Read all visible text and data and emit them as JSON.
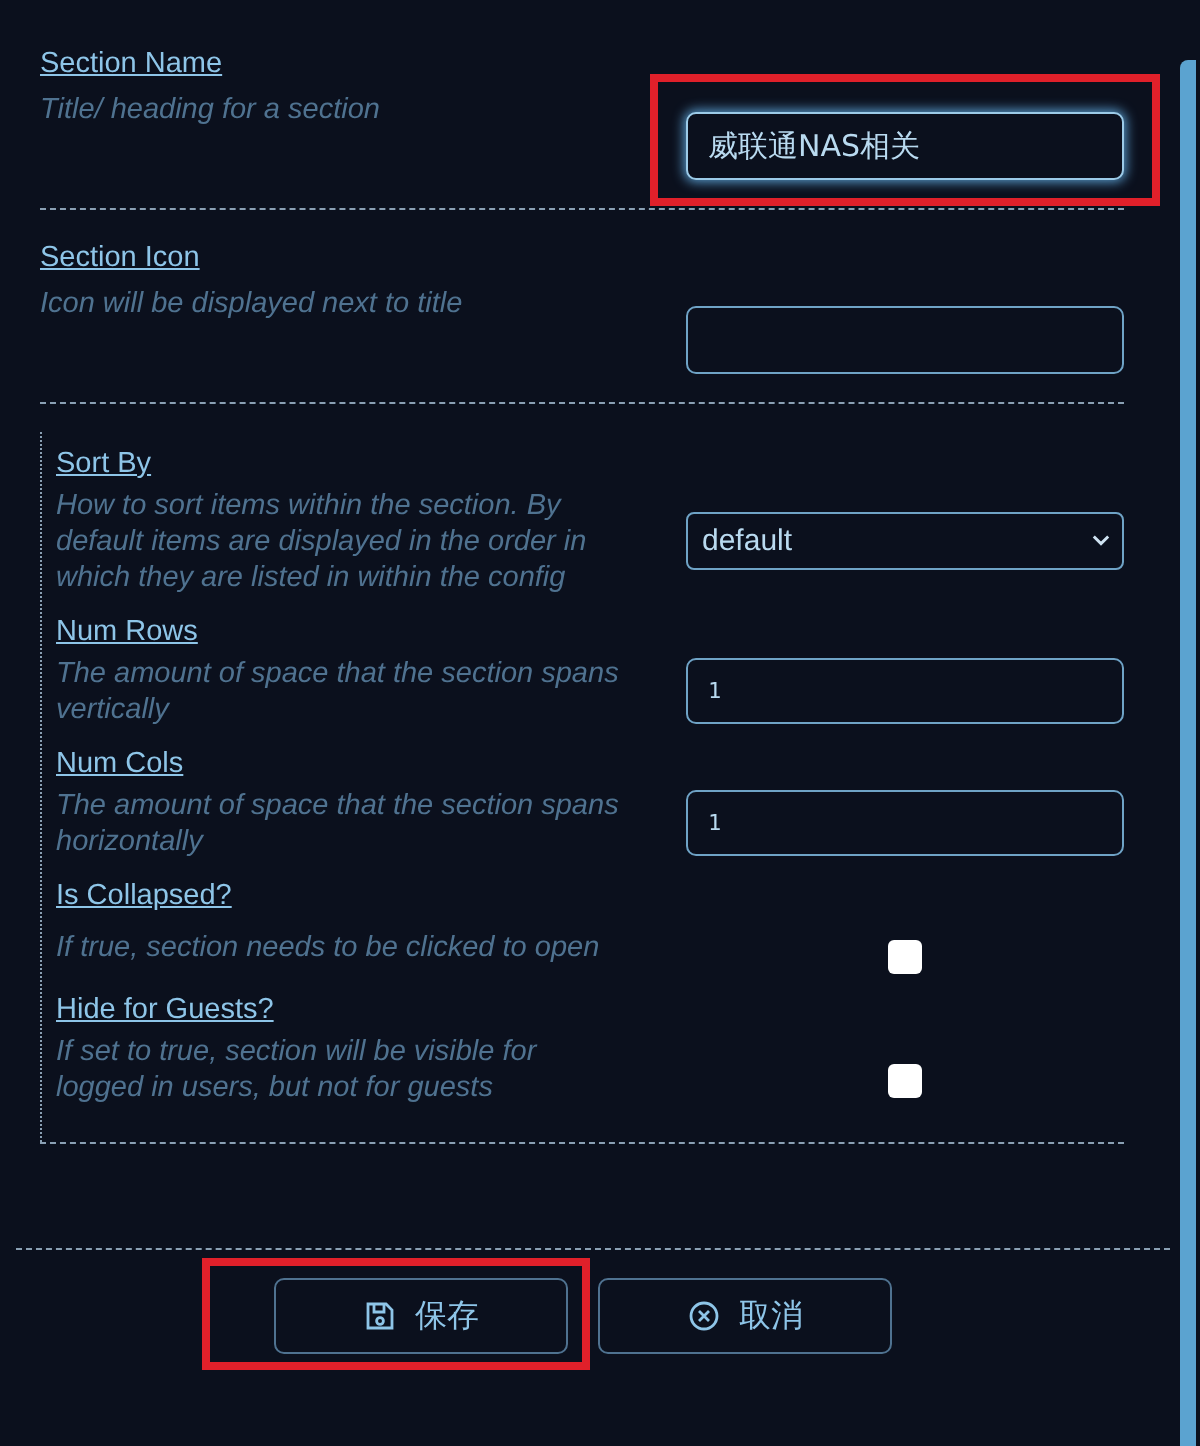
{
  "fields": [
    {
      "kind": "text",
      "label": "Section Name",
      "description": "Title/ heading for a section",
      "value": "威联通NAS相关",
      "focused": true,
      "highlighted": true
    },
    {
      "kind": "text",
      "label": "Section Icon",
      "description": "Icon will be displayed next to title",
      "focused": false,
      "highlighted": false
    }
  ],
  "display_options": [
    {
      "kind": "select",
      "label": "Sort By",
      "description": "How to sort items within the section. By default items are displayed in the order in which they are listed in within the config",
      "value": "default"
    },
    {
      "kind": "number",
      "label": "Num Rows",
      "description": "The amount of space that the section spans vertically",
      "value": "1"
    },
    {
      "kind": "number",
      "label": "Num Cols",
      "description": "The amount of space that the section spans horizontally",
      "value": "1"
    },
    {
      "kind": "checkbox",
      "label": "Is Collapsed?",
      "description": "If true, section needs to be clicked to open",
      "checked": false
    },
    {
      "kind": "checkbox",
      "label": "Hide for Guests?",
      "description": "If set to true, section will be visible for logged in users, but not for guests",
      "checked": false
    }
  ],
  "buttons": [
    {
      "kind": "save",
      "label": "保存",
      "highlighted": true
    },
    {
      "kind": "cancel",
      "label": "取消",
      "highlighted": false
    }
  ]
}
